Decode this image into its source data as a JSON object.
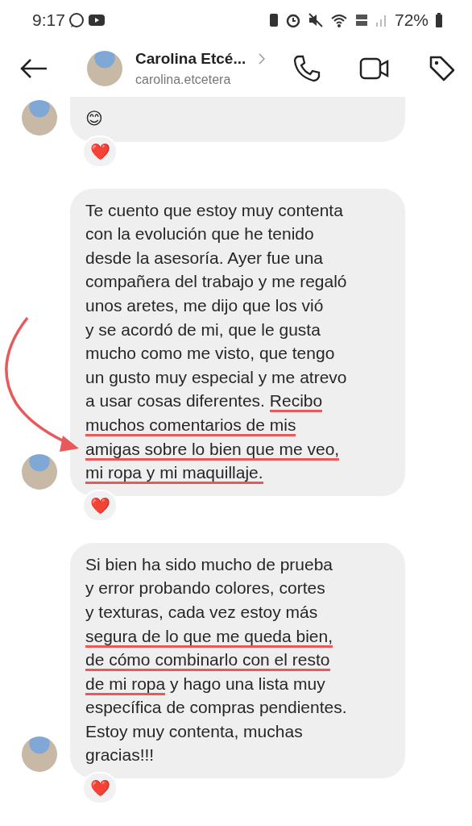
{
  "status_bar": {
    "time": "9:17",
    "battery": "72%"
  },
  "header": {
    "name": "Carolina Etcé...",
    "username": "carolina.etcetera"
  },
  "messages": [
    {
      "lines": [
        [
          {
            "text": "😊",
            "underlined": false
          }
        ]
      ],
      "reaction": "❤️",
      "cut_top": true
    },
    {
      "lines": [
        [
          {
            "text": "Te cuento que estoy muy contenta",
            "underlined": false
          }
        ],
        [
          {
            "text": "con la evolución que he tenido",
            "underlined": false
          }
        ],
        [
          {
            "text": "desde la asesoría. Ayer fue una",
            "underlined": false
          }
        ],
        [
          {
            "text": "compañera del trabajo y me regaló",
            "underlined": false
          }
        ],
        [
          {
            "text": "unos aretes, me dijo que los vió",
            "underlined": false
          }
        ],
        [
          {
            "text": "y se acordó de mi, que le gusta",
            "underlined": false
          }
        ],
        [
          {
            "text": "mucho como me visto, que tengo",
            "underlined": false
          }
        ],
        [
          {
            "text": "un gusto muy especial y me atrevo",
            "underlined": false
          }
        ],
        [
          {
            "text": "a usar cosas diferentes. ",
            "underlined": false
          },
          {
            "text": "Recibo",
            "underlined": true
          }
        ],
        [
          {
            "text": "muchos comentarios de mis",
            "underlined": true
          }
        ],
        [
          {
            "text": "amigas sobre lo bien que me veo,",
            "underlined": true
          }
        ],
        [
          {
            "text": "mi ropa y mi maquillaje.",
            "underlined": true
          }
        ]
      ],
      "reaction": "❤️",
      "cut_top": false,
      "arrow": true
    },
    {
      "lines": [
        [
          {
            "text": "Si bien ha sido mucho de prueba",
            "underlined": false
          }
        ],
        [
          {
            "text": "y error probando colores, cortes",
            "underlined": false
          }
        ],
        [
          {
            "text": "y texturas, cada vez estoy más",
            "underlined": false
          }
        ],
        [
          {
            "text": "segura de lo que me queda bien,",
            "underlined": true
          }
        ],
        [
          {
            "text": "de cómo combinarlo con el resto",
            "underlined": true
          }
        ],
        [
          {
            "text": "de mi ropa",
            "underlined": true
          },
          {
            "text": " y hago una lista muy",
            "underlined": false
          }
        ],
        [
          {
            "text": "específica de compras pendientes.",
            "underlined": false
          }
        ],
        [
          {
            "text": "Estoy muy contenta, muchas",
            "underlined": false
          }
        ],
        [
          {
            "text": "gracias!!!",
            "underlined": false
          }
        ]
      ],
      "reaction": "❤️",
      "cut_top": false
    }
  ]
}
